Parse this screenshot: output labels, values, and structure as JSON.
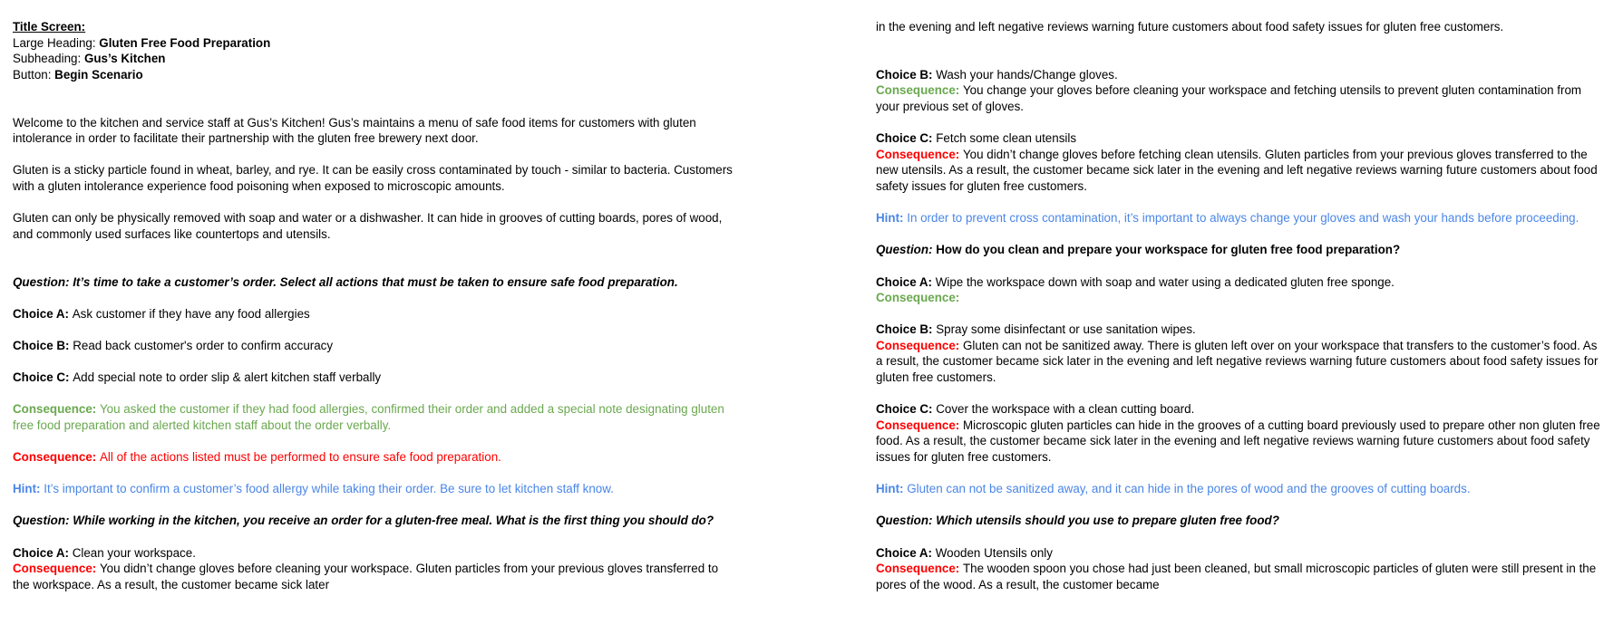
{
  "left": {
    "title_screen": {
      "heading": "Title Screen:",
      "large_heading_label": "Large Heading: ",
      "large_heading_value": "Gluten Free Food Preparation",
      "subheading_label": "Subheading: ",
      "subheading_value": "Gus’s Kitchen",
      "button_label": "Button: ",
      "button_value": "Begin Scenario"
    },
    "intro": [
      "Welcome to the kitchen and service staff at Gus’s Kitchen! Gus’s maintains a menu of safe food items for customers with gluten intolerance in order to facilitate their partnership with the gluten free brewery next door.",
      "Gluten is a sticky particle found in wheat, barley, and rye. It can be easily cross contaminated by touch - similar to bacteria. Customers with a gluten intolerance experience food poisoning when exposed to microscopic amounts.",
      "Gluten can only be physically removed with soap and water or a dishwasher. It can hide in grooves of cutting boards, pores of wood, and commonly used surfaces like countertops and utensils."
    ],
    "q1": {
      "question": "Question: It’s time to take a customer’s order. Select all actions that must be taken to ensure safe food preparation.",
      "choice_a_label": "Choice A: ",
      "choice_a_text": "Ask customer if they have any food allergies",
      "choice_b_label": "Choice B: ",
      "choice_b_text": "Read back customer's order to confirm accuracy",
      "choice_c_label": "Choice C: ",
      "choice_c_text": "Add special note to order slip & alert kitchen staff verbally",
      "consequence_good_label": "Consequence: ",
      "consequence_good_text": "You asked the customer if they had food allergies, confirmed their order and added a special note designating gluten free food preparation and alerted kitchen staff about the order verbally.",
      "consequence_bad_label": "Consequence: ",
      "consequence_bad_text": "All of the actions listed must be performed to ensure safe food preparation.",
      "hint_label": "Hint: ",
      "hint_text": "It’s important to confirm a customer’s food allergy while taking their order. Be sure to let kitchen staff know."
    },
    "q2": {
      "question": "Question: While working in the kitchen, you receive an order for a gluten-free meal. What is the first thing you should do?",
      "choice_a_label": "Choice A: ",
      "choice_a_text": "Clean your workspace.",
      "consequence_a_label": "Consequence: ",
      "consequence_a_text": "You didn’t change gloves before cleaning your workspace. Gluten particles from your previous gloves transferred to the workspace. As a result, the customer became sick later"
    }
  },
  "right": {
    "q2_cont": {
      "continuation": "in the evening and left negative reviews warning future customers about food safety issues for gluten free customers.",
      "choice_b_label": "Choice B: ",
      "choice_b_text": "Wash your hands/Change gloves.",
      "consequence_b_label": "Consequence: ",
      "consequence_b_text": "You change your gloves before cleaning your workspace and fetching utensils to prevent gluten contamination from your previous set of gloves.",
      "choice_c_label": "Choice C: ",
      "choice_c_text": "Fetch some clean utensils",
      "consequence_c_label": "Consequence: ",
      "consequence_c_text": "You didn’t change gloves before fetching clean utensils. Gluten particles from your previous gloves transferred to the new utensils. As a result, the customer became sick later in the evening and left negative reviews warning future customers about food safety issues for gluten free customers.",
      "hint_label": "Hint: ",
      "hint_text": "In order to prevent cross contamination, it’s important to always change your gloves and wash your hands before proceeding."
    },
    "q3": {
      "question_label": "Question: ",
      "question_text": "How do you clean and prepare your workspace for gluten free food preparation?",
      "choice_a_label": "Choice A: ",
      "choice_a_text": "Wipe the workspace down with soap and water using a dedicated gluten free sponge.",
      "consequence_a_label": "Consequence:",
      "choice_b_label": "Choice B: ",
      "choice_b_text": "Spray some disinfectant or use sanitation wipes.",
      "consequence_b_label": "Consequence: ",
      "consequence_b_text": "Gluten can not be sanitized away. There is gluten left over on your workspace that transfers to the customer’s food. As a result, the customer became sick later in the evening and left negative reviews warning future customers about food safety issues for gluten free customers.",
      "choice_c_label": "Choice C: ",
      "choice_c_text": "Cover the workspace with a clean cutting board.",
      "consequence_c_label": "Consequence: ",
      "consequence_c_text": "Microscopic gluten particles can hide in the grooves of a cutting board previously used to prepare other non gluten free food. As a result, the customer became sick later in the evening and left negative reviews warning future customers about food safety issues for gluten free customers.",
      "hint_label": "Hint: ",
      "hint_text": "Gluten can not be sanitized away, and it can hide in the pores of wood and the grooves of cutting boards."
    },
    "q4": {
      "question": "Question: Which utensils should you use to prepare gluten free food?",
      "choice_a_label": "Choice A: ",
      "choice_a_text": "Wooden Utensils only",
      "consequence_a_label": "Consequence: ",
      "consequence_a_text": "The wooden spoon you chose had just been cleaned, but small microscopic particles of gluten were still present in the pores of the wood. As a result, the customer became"
    }
  },
  "colors": {
    "good": "#6aa84f",
    "bad": "#ff0000",
    "hint": "#4a86e8"
  }
}
